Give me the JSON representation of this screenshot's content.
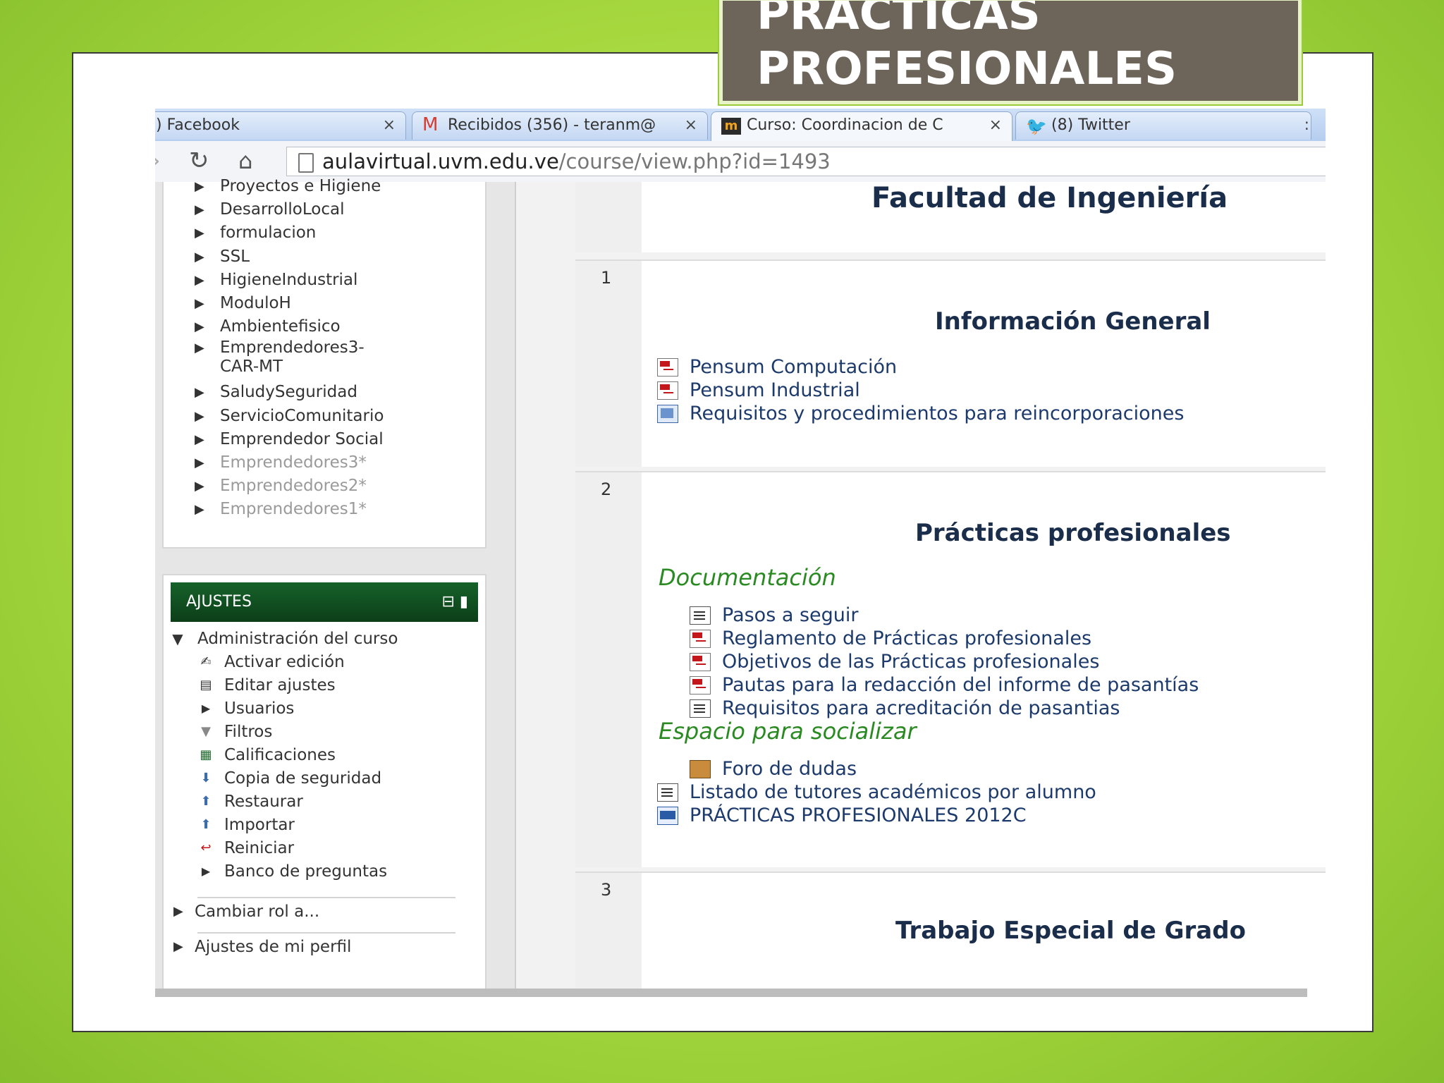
{
  "slide_title": [
    "PRACTICAS",
    "PROFESIONALES"
  ],
  "browser": {
    "tabs": [
      {
        "label": ") Facebook",
        "close": "×"
      },
      {
        "label": "Recibidos (356) - teranm@",
        "close": "×"
      },
      {
        "label": "Curso: Coordinacion de C",
        "close": "×"
      },
      {
        "label": "(8) Twitter",
        "close": ":"
      }
    ],
    "url_host": "aulavirtual.uvm.edu.ve",
    "url_path": "/course/view.php?id=1493"
  },
  "nav_items": [
    "Proyectos e Higiene",
    "DesarrolloLocal",
    "formulacion",
    "SSL",
    "HigieneIndustrial",
    "ModuloH",
    "Ambientefisico",
    "Emprendedores3-",
    "CAR-MT",
    "SaludySeguridad",
    "ServicioComunitario",
    "Emprendedor Social",
    "Emprendedores3*",
    "Emprendedores2*",
    "Emprendedores1*"
  ],
  "settings": {
    "header": "AJUSTES",
    "admin_label": "Administración del curso",
    "items": [
      "Activar edición",
      "Editar ajustes",
      "Usuarios",
      "Filtros",
      "Calificaciones",
      "Copia de seguridad",
      "Restaurar",
      "Importar",
      "Reiniciar",
      "Banco de preguntas"
    ],
    "switch_role": "Cambiar rol a...",
    "profile": "Ajustes de mi perfil"
  },
  "course": {
    "faculty_title": "Facultad de Ingeniería",
    "sections": [
      {
        "num": "1",
        "title": "Información General",
        "links": [
          "Pensum Computación",
          "Pensum Industrial",
          "Requisitos y procedimientos para reincorporaciones"
        ]
      },
      {
        "num": "2",
        "title": "Prácticas profesionales",
        "sub1": "Documentación",
        "doc_links": [
          "Pasos a seguir",
          "Reglamento de Prácticas profesionales",
          "Objetivos de las Prácticas profesionales",
          "Pautas para la redacción del informe de pasantías",
          "Requisitos para acreditación de pasantias"
        ],
        "sub2": "Espacio para socializar",
        "forum": "Foro de dudas",
        "extra_links": [
          "Listado de tutores académicos por alumno",
          "PRÁCTICAS PROFESIONALES 2012C"
        ]
      },
      {
        "num": "3",
        "title": "Trabajo Especial de Grado"
      }
    ]
  }
}
